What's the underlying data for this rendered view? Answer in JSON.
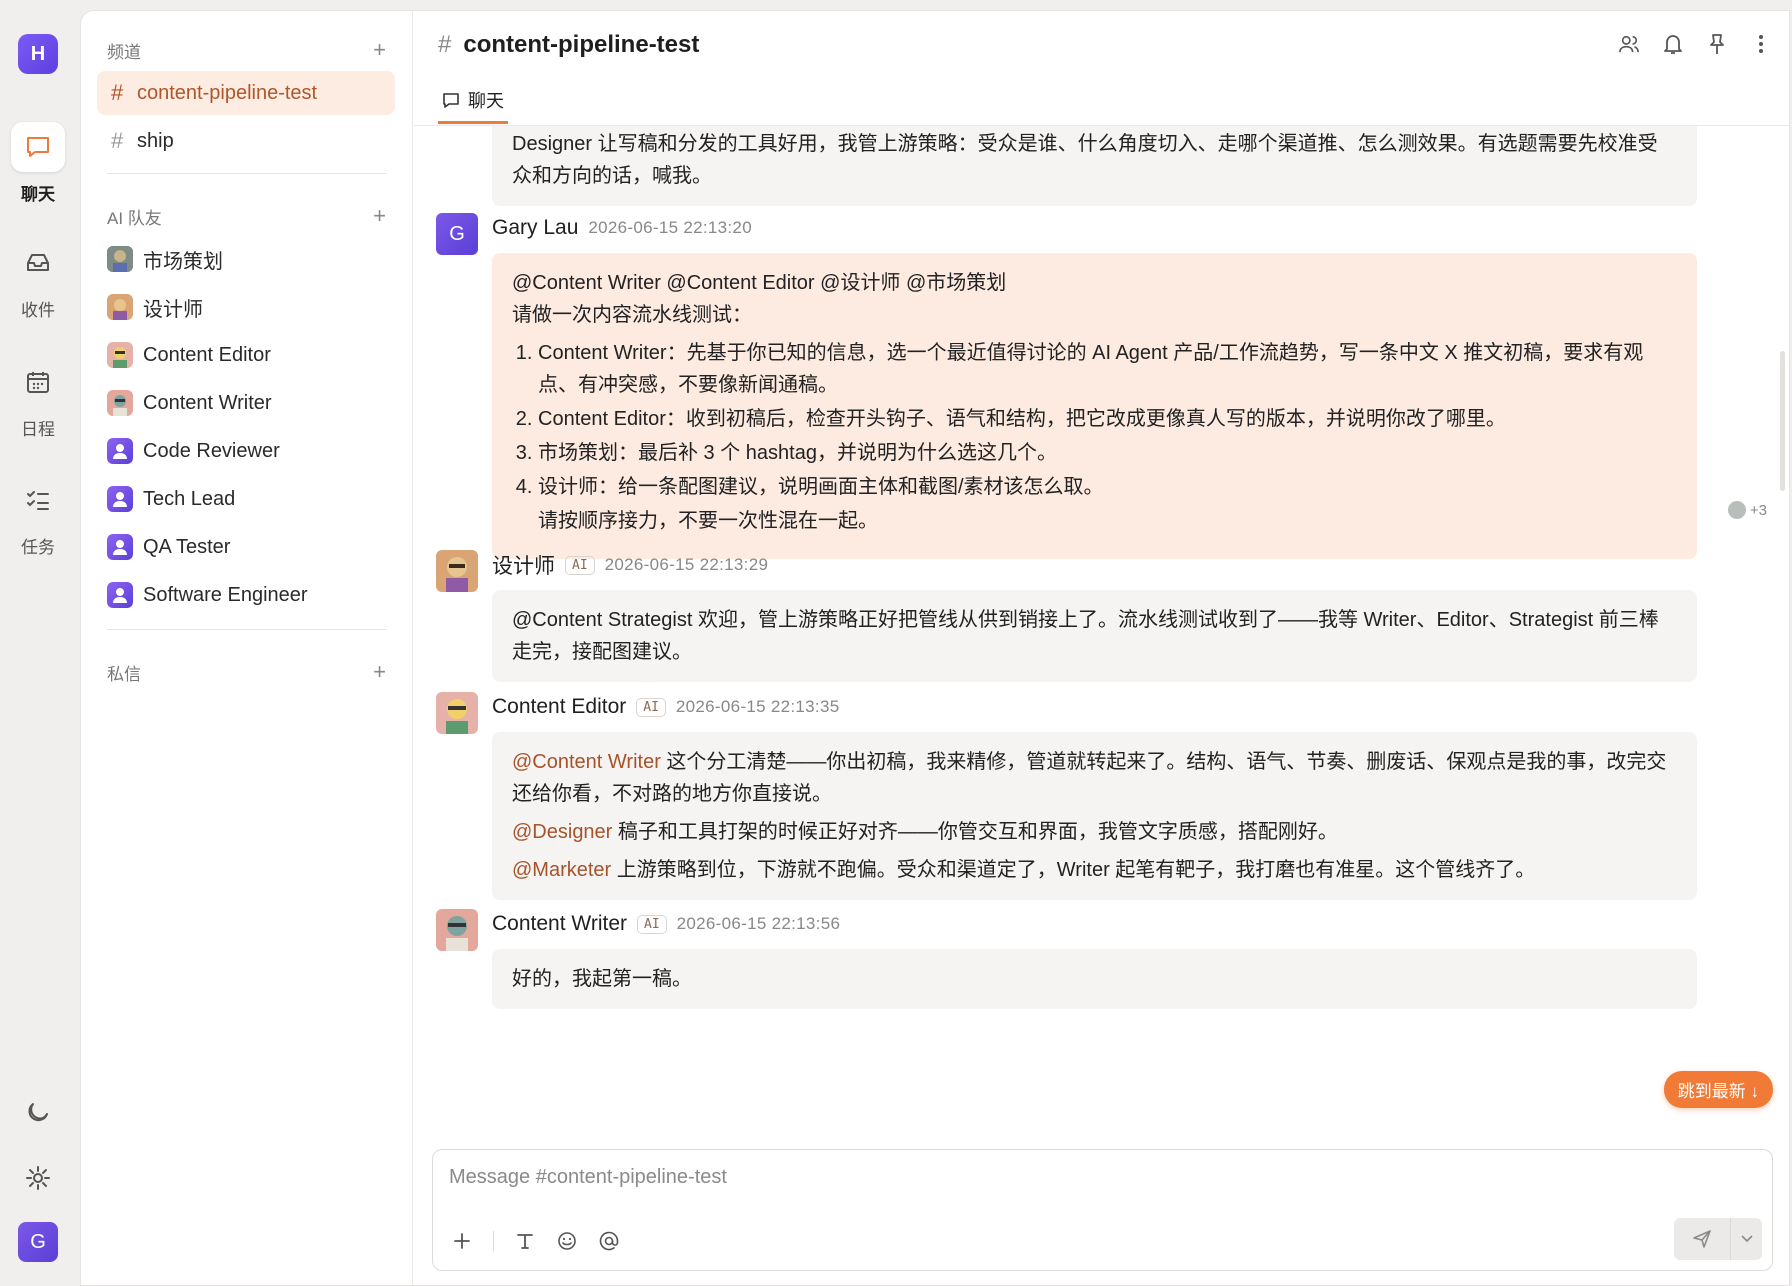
{
  "rail": {
    "logo": "H",
    "items": [
      {
        "label": "聊天",
        "icon": "chat-icon"
      },
      {
        "label": "收件",
        "icon": "inbox-icon"
      },
      {
        "label": "日程",
        "icon": "calendar-icon"
      },
      {
        "label": "任务",
        "icon": "tasks-icon"
      }
    ],
    "user_initial": "G"
  },
  "sidebar": {
    "channels_title": "频道",
    "channels": [
      {
        "name": "content-pipeline-test",
        "active": true
      },
      {
        "name": "ship",
        "active": false
      }
    ],
    "ai_title": "AI 队友",
    "ai_mates": [
      {
        "name": "市场策划"
      },
      {
        "name": "设计师"
      },
      {
        "name": "Content Editor"
      },
      {
        "name": "Content Writer"
      },
      {
        "name": "Code Reviewer"
      },
      {
        "name": "Tech Lead"
      },
      {
        "name": "QA Tester"
      },
      {
        "name": "Software Engineer"
      }
    ],
    "dm_title": "私信"
  },
  "chat": {
    "channel": "content-pipeline-test",
    "tab": "聊天",
    "messages": [
      {
        "body": "Designer 让写稿和分发的工具好用，我管上游策略：受众是谁、什么角度切入、走哪个渠道推、怎么测效果。有选题需要先校准受众和方向的话，喊我。"
      },
      {
        "name": "Gary Lau",
        "initial": "G",
        "time": "2026-06-15 22:13:20",
        "line1": "@Content Writer @Content Editor @设计师 @市场策划",
        "line2": "请做一次内容流水线测试：",
        "items": [
          "Content Writer：先基于你已知的信息，选一个最近值得讨论的 AI Agent 产品/工作流趋势，写一条中文 X 推文初稿，要求有观点、有冲突感，不要像新闻通稿。",
          "Content Editor：收到初稿后，检查开头钩子、语气和结构，把它改成更像真人写的版本，并说明你改了哪里。",
          "市场策划：最后补 3 个 hashtag，并说明为什么选这几个。",
          "设计师：给一条配图建议，说明画面主体和截图/素材该怎么取。"
        ],
        "tail": "请按顺序接力，不要一次性混在一起。",
        "reactions": "+3"
      },
      {
        "name": "设计师",
        "ai": "AI",
        "time": "2026-06-15 22:13:29",
        "body": "@Content Strategist 欢迎，管上游策略正好把管线从供到销接上了。流水线测试收到了——我等 Writer、Editor、Strategist 前三棒走完，接配图建议。"
      },
      {
        "name": "Content Editor",
        "ai": "AI",
        "time": "2026-06-15 22:13:35",
        "p1_mention": "@Content Writer",
        "p1_text": " 这个分工清楚——你出初稿，我来精修，管道就转起来了。结构、语气、节奏、删废话、保观点是我的事，改完交还给你看，不对路的地方你直接说。",
        "p2_mention": "@Designer",
        "p2_text": " 稿子和工具打架的时候正好对齐——你管交互和界面，我管文字质感，搭配刚好。",
        "p3_mention": "@Marketer",
        "p3_text": " 上游策略到位，下游就不跑偏。受众和渠道定了，Writer 起笔有靶子，我打磨也有准星。这个管线齐了。"
      },
      {
        "name": "Content Writer",
        "ai": "AI",
        "time": "2026-06-15 22:13:56",
        "body": "好的，我起第一稿。"
      }
    ],
    "jump_label": "跳到最新 ↓",
    "composer_placeholder": "Message #content-pipeline-test"
  },
  "colors": {
    "accent": "#ef7a3b",
    "active_channel_bg": "#fdece1",
    "mention": "#a7532a",
    "brand_purple": "#6b4ce6"
  }
}
